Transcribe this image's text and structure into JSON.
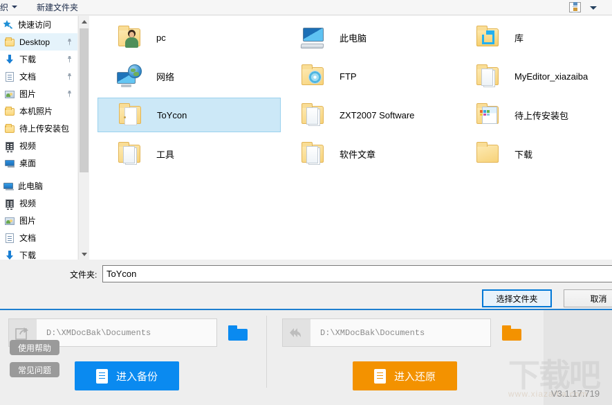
{
  "dialog": {
    "toolbar": {
      "organize_label": "组织",
      "new_folder_label": "新建文件夹",
      "view_icon": "view-list-icon",
      "view_caret": "chevron-down-icon"
    },
    "sidebar": {
      "groups": [
        {
          "header": {
            "label": "快速访问",
            "icon": "star-pin-icon"
          },
          "items": [
            {
              "label": "Desktop",
              "icon": "folder-icon",
              "pinned": true,
              "selected": true
            },
            {
              "label": "下载",
              "icon": "download-arrow-icon",
              "pinned": true,
              "selected": false
            },
            {
              "label": "文档",
              "icon": "document-icon",
              "pinned": true,
              "selected": false
            },
            {
              "label": "图片",
              "icon": "picture-icon",
              "pinned": true,
              "selected": false
            },
            {
              "label": "本机照片",
              "icon": "folder-icon",
              "pinned": false,
              "selected": false
            },
            {
              "label": "待上传安装包",
              "icon": "folder-icon",
              "pinned": false,
              "selected": false
            },
            {
              "label": "视频",
              "icon": "video-icon",
              "pinned": false,
              "selected": false
            },
            {
              "label": "桌面",
              "icon": "desktop-icon",
              "pinned": false,
              "selected": false
            }
          ]
        },
        {
          "header": {
            "label": "此电脑",
            "icon": "computer-icon"
          },
          "items": [
            {
              "label": "视频",
              "icon": "video-icon",
              "pinned": false,
              "selected": false
            },
            {
              "label": "图片",
              "icon": "picture-icon",
              "pinned": false,
              "selected": false
            },
            {
              "label": "文档",
              "icon": "document-icon",
              "pinned": false,
              "selected": false
            },
            {
              "label": "下载",
              "icon": "download-arrow-icon",
              "pinned": false,
              "selected": false
            }
          ]
        }
      ],
      "scrollbar": {
        "up_arrow": "chevron-up-icon",
        "down_arrow": "chevron-down-icon"
      }
    },
    "files": [
      {
        "label": "pc",
        "icon": "user-folder-icon",
        "col": 0,
        "row": 0,
        "selected": false
      },
      {
        "label": "网络",
        "icon": "network-icon",
        "col": 0,
        "row": 1,
        "selected": false
      },
      {
        "label": "ToYcon",
        "icon": "open-folder-icon",
        "col": 0,
        "row": 2,
        "selected": true
      },
      {
        "label": "工具",
        "icon": "folder-documents-icon",
        "col": 0,
        "row": 3,
        "selected": false
      },
      {
        "label": "此电脑",
        "icon": "computer-monitor-icon",
        "col": 1,
        "row": 0,
        "selected": false
      },
      {
        "label": "FTP",
        "icon": "folder-disc-icon",
        "col": 1,
        "row": 1,
        "selected": false
      },
      {
        "label": "ZXT2007 Software",
        "icon": "folder-documents-icon",
        "col": 1,
        "row": 2,
        "selected": false
      },
      {
        "label": "软件文章",
        "icon": "folder-documents-icon",
        "col": 1,
        "row": 3,
        "selected": false
      },
      {
        "label": "库",
        "icon": "library-folder-icon",
        "col": 2,
        "row": 0,
        "selected": false
      },
      {
        "label": "MyEditor_xiazaiba",
        "icon": "folder-documents-icon",
        "col": 2,
        "row": 1,
        "selected": false
      },
      {
        "label": "待上传安装包",
        "icon": "folder-image-icon",
        "col": 2,
        "row": 2,
        "selected": false
      },
      {
        "label": "下载",
        "icon": "folder-icon",
        "col": 2,
        "row": 3,
        "selected": false
      }
    ],
    "filename": {
      "label": "文件夹:",
      "value": "ToYcon",
      "placeholder": ""
    },
    "actions": {
      "select_label": "选择文件夹",
      "cancel_label": "取消"
    }
  },
  "app": {
    "backup": {
      "icon": "export-arrow-icon",
      "path": "D:\\XMDocBak\\Documents",
      "browse_icon": "folder-blue-icon",
      "button_label": "进入备份",
      "button_icon": "document-icon",
      "accent": "#0a8af0"
    },
    "restore": {
      "icon": "restore-arrows-icon",
      "path": "D:\\XMDocBak\\Documents",
      "browse_icon": "folder-orange-icon",
      "button_label": "进入还原",
      "button_icon": "document-icon",
      "accent": "#f39200"
    },
    "help": {
      "help_label": "使用帮助",
      "faq_label": "常见问题",
      "version": "V3.1.17.719"
    },
    "watermark": {
      "main": "下载吧",
      "sub": "www.xiazaiba.com"
    }
  }
}
